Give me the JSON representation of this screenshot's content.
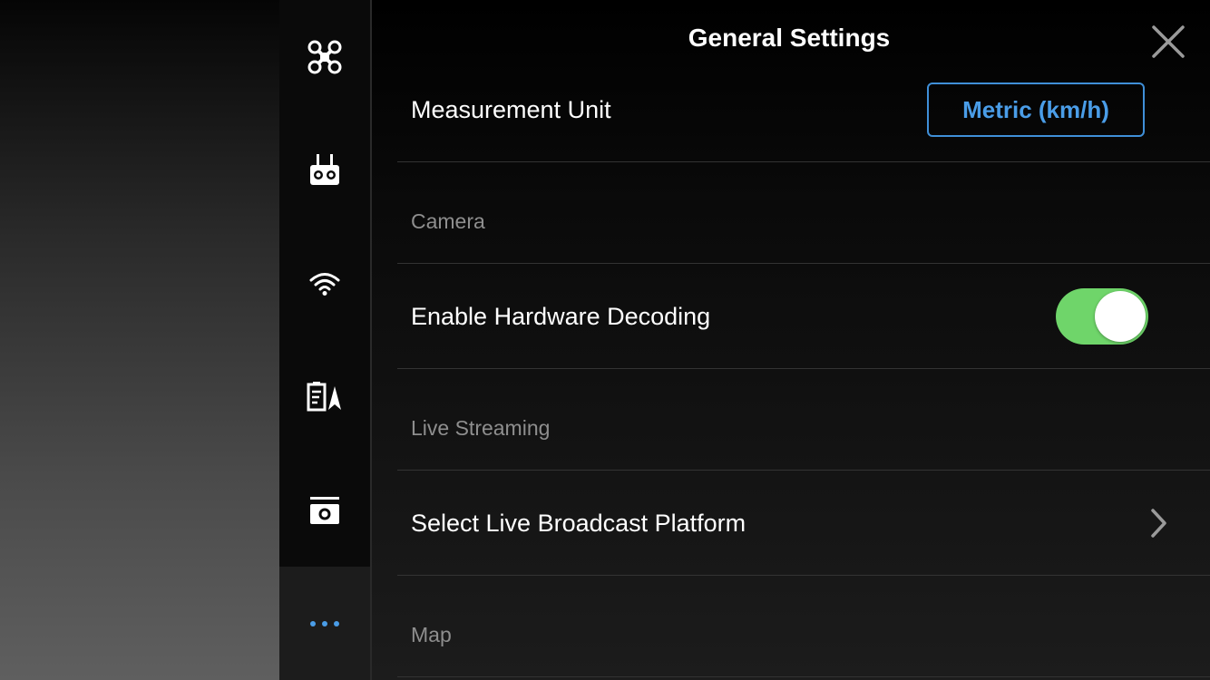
{
  "panel": {
    "title": "General Settings"
  },
  "nav": {
    "items": [
      {
        "icon": "drone-icon"
      },
      {
        "icon": "remote-controller-icon"
      },
      {
        "icon": "wifi-icon"
      },
      {
        "icon": "battery-flight-icon"
      },
      {
        "icon": "camera-icon"
      },
      {
        "icon": "more-dots-icon",
        "active": true
      }
    ]
  },
  "settings": {
    "measurement_unit": {
      "label": "Measurement Unit",
      "value": "Metric (km/h)"
    },
    "camera_section": "Camera",
    "hardware_decoding": {
      "label": "Enable Hardware Decoding",
      "enabled": true
    },
    "live_streaming_section": "Live Streaming",
    "broadcast_platform": {
      "label": "Select Live Broadcast Platform"
    },
    "map_section": "Map"
  },
  "colors": {
    "accent_blue": "#4a9de8",
    "toggle_on": "#6fd56a",
    "section_gray": "#8e8e8e"
  }
}
